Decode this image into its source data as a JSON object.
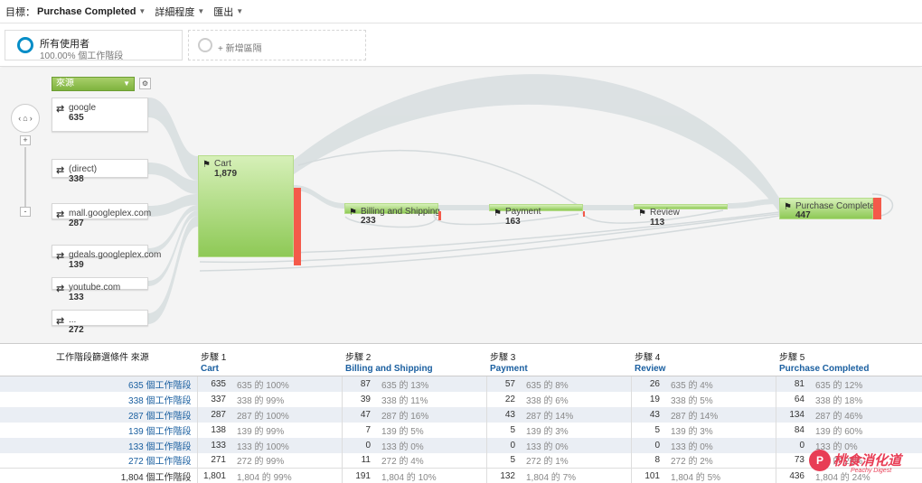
{
  "toolbar": {
    "goal_label": "目標：",
    "goal_value": "Purchase Completed",
    "detail_label": "詳細程度",
    "export_label": "匯出"
  },
  "segments": {
    "seg1_title": "所有使用者",
    "seg1_sub": "100.00% 個工作階段",
    "seg2_add": "+ 新增區隔"
  },
  "flow": {
    "source_select": "來源",
    "sources": [
      {
        "name": "google",
        "count": "635"
      },
      {
        "name": "(direct)",
        "count": "338"
      },
      {
        "name": "mall.googleplex.com",
        "count": "287"
      },
      {
        "name": "gdeals.googleplex.com",
        "count": "139"
      },
      {
        "name": "youtube.com",
        "count": "133"
      },
      {
        "name": "...",
        "count": "272"
      }
    ],
    "steps": [
      {
        "name": "Cart",
        "count": "1,879"
      },
      {
        "name": "Billing and Shipping",
        "count": "233"
      },
      {
        "name": "Payment",
        "count": "163"
      },
      {
        "name": "Review",
        "count": "113"
      },
      {
        "name": "Purchase Completed",
        "count": "447"
      }
    ]
  },
  "table": {
    "dim_header": "工作階段篩選條件 來源",
    "steps": [
      {
        "label": "步驟 1",
        "name": "Cart"
      },
      {
        "label": "步驟 2",
        "name": "Billing and Shipping"
      },
      {
        "label": "步驟 3",
        "name": "Payment"
      },
      {
        "label": "步驟 4",
        "name": "Review"
      },
      {
        "label": "步驟 5",
        "name": "Purchase Completed"
      }
    ],
    "rows": [
      {
        "source": "google",
        "sessions": "635 個工作階段",
        "cells": [
          [
            "635",
            "635 的 100%"
          ],
          [
            "87",
            "635 的 13%"
          ],
          [
            "57",
            "635 的 8%"
          ],
          [
            "26",
            "635 的 4%"
          ],
          [
            "81",
            "635 的 12%"
          ]
        ]
      },
      {
        "source": "(direct)",
        "sessions": "338 個工作階段",
        "cells": [
          [
            "337",
            "338 的 99%"
          ],
          [
            "39",
            "338 的 11%"
          ],
          [
            "22",
            "338 的 6%"
          ],
          [
            "19",
            "338 的 5%"
          ],
          [
            "64",
            "338 的 18%"
          ]
        ]
      },
      {
        "source": "mall.googleplex.com",
        "sessions": "287 個工作階段",
        "cells": [
          [
            "287",
            "287 的 100%"
          ],
          [
            "47",
            "287 的 16%"
          ],
          [
            "43",
            "287 的 14%"
          ],
          [
            "43",
            "287 的 14%"
          ],
          [
            "134",
            "287 的 46%"
          ]
        ]
      },
      {
        "source": "gdeals.googleplex.com",
        "sessions": "139 個工作階段",
        "cells": [
          [
            "138",
            "139 的 99%"
          ],
          [
            "7",
            "139 的 5%"
          ],
          [
            "5",
            "139 的 3%"
          ],
          [
            "5",
            "139 的 3%"
          ],
          [
            "84",
            "139 的 60%"
          ]
        ]
      },
      {
        "source": "youtube.com",
        "sessions": "133 個工作階段",
        "cells": [
          [
            "133",
            "133 的 100%"
          ],
          [
            "0",
            "133 的 0%"
          ],
          [
            "0",
            "133 的 0%"
          ],
          [
            "0",
            "133 的 0%"
          ],
          [
            "0",
            "133 的 0%"
          ]
        ]
      },
      {
        "source": "...",
        "sessions": "272 個工作階段",
        "cells": [
          [
            "271",
            "272 的 99%"
          ],
          [
            "11",
            "272 的 4%"
          ],
          [
            "5",
            "272 的 1%"
          ],
          [
            "8",
            "272 的 2%"
          ],
          [
            "73",
            "272 的 26%"
          ]
        ]
      }
    ],
    "total": {
      "label": "總計",
      "sessions": "1,804 個工作階段",
      "cells": [
        [
          "1,801",
          "1,804 的 99%"
        ],
        [
          "191",
          "1,804 的 10%"
        ],
        [
          "132",
          "1,804 的 7%"
        ],
        [
          "101",
          "1,804 的 5%"
        ],
        [
          "436",
          "1,804 的 24%"
        ]
      ]
    }
  },
  "watermark": {
    "text": "桃食消化道",
    "sub": "Peachy Digest",
    "badge": "P"
  }
}
